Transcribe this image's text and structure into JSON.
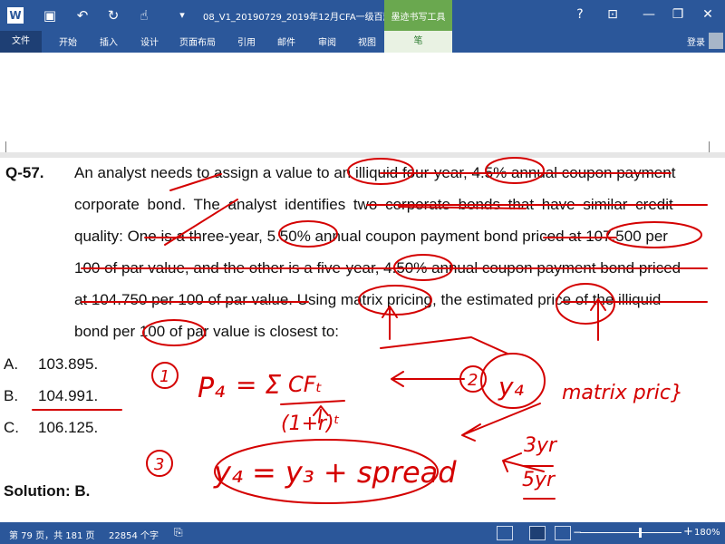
{
  "titlebar": {
    "doc_title": "08_V1_20190729_2019年12月CFA一级百题...",
    "contextual_group": "墨迹书写工具",
    "icons": [
      "word-app-icon",
      "save-icon",
      "undo-icon",
      "redo-icon",
      "touch-mode-icon",
      "customize-icon",
      "help-icon",
      "ribbon-display-icon",
      "minimize-icon",
      "maximize-icon",
      "close-icon"
    ]
  },
  "ribbon": {
    "tabs": [
      "文件",
      "开始",
      "插入",
      "设计",
      "页面布局",
      "引用",
      "邮件",
      "审阅",
      "视图"
    ],
    "contextual_tab": "笔",
    "login": "登录"
  },
  "document": {
    "question_label": "Q-57.",
    "question_lines": [
      "An analyst needs to assign a value to an illiquid four-year, 4.5% annual coupon payment",
      "corporate bond. The analyst identifies two corporate bonds that have similar credit",
      "quality: One is a three-year, 5.50% annual coupon payment bond priced at 107.500 per",
      "100 of par value, and the other is a five-year, 4.50% annual coupon payment bond priced",
      "at 104.750 per 100 of par value. Using matrix pricing, the estimated price of the illiquid",
      "bond per 100 of par value is closest to:"
    ],
    "options": [
      {
        "letter": "A.",
        "value": "103.895."
      },
      {
        "letter": "B.",
        "value": "104.991."
      },
      {
        "letter": "C.",
        "value": "106.125."
      }
    ],
    "solution": "Solution: B."
  },
  "ink": {
    "color": "#d40000",
    "step1_num": "1",
    "step2_num": "2",
    "step3_num": "3",
    "formula_lhs": "P₄",
    "formula_eq": "= Σ",
    "formula_num": "CFₜ",
    "formula_den": "(1+r)ᵗ",
    "step2_var": "y₄",
    "step2_note": "matrix pric}",
    "step3_formula": "y₄ = y₃ + spread",
    "yr3": "3yr",
    "yr5": "5yr"
  },
  "statusbar": {
    "page_info": "第 79 页，共 181 页",
    "word_count": "22854 个字",
    "zoom": "180%",
    "zoom_minus": "−",
    "zoom_plus": "+"
  }
}
